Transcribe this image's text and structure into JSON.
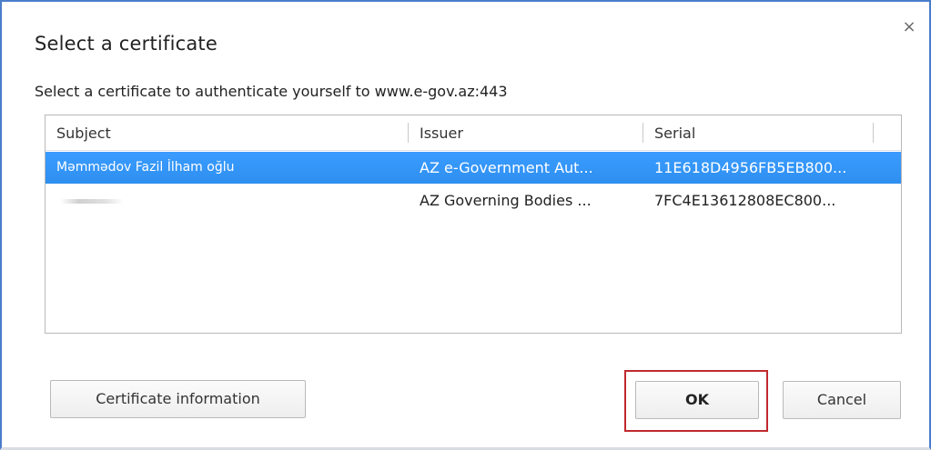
{
  "dialog": {
    "title": "Select a certificate",
    "close_glyph": "×",
    "description": "Select a certificate to authenticate yourself to www.e-gov.az:443"
  },
  "table": {
    "columns": [
      "Subject",
      "Issuer",
      "Serial"
    ],
    "rows": [
      {
        "subject": "Məmmədov Fazil İlham oğlu",
        "issuer": "AZ e-Government Aut...",
        "serial": "11E618D4956FB5EB800...",
        "selected": true
      },
      {
        "subject": "",
        "issuer": "AZ Governing Bodies ...",
        "serial": "7FC4E13612808EC800...",
        "selected": false
      }
    ]
  },
  "buttons": {
    "certificate_info": "Certificate information",
    "ok": "OK",
    "cancel": "Cancel"
  },
  "colors": {
    "selection": "#3399ff",
    "highlight_frame": "#c0292d",
    "window_border": "#4a7cc9"
  }
}
